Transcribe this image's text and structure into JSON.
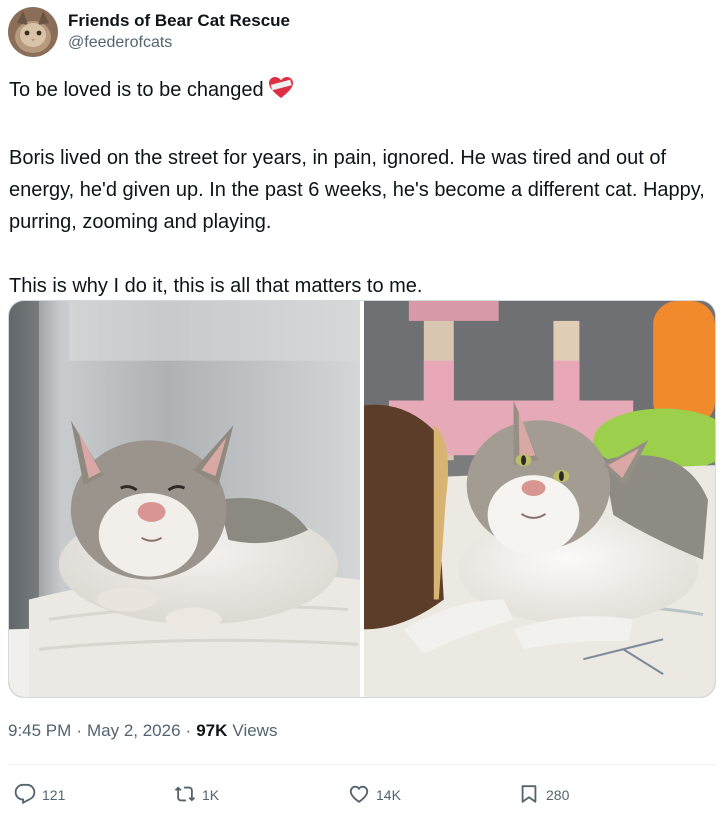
{
  "tweet": {
    "author": {
      "display_name": "Friends of Bear Cat Rescue",
      "handle": "@feederofcats"
    },
    "text": {
      "line1": "To be loved is to be changed",
      "line1_emoji": "heart-with-bandage",
      "para2": "Boris lived on the street for years, in pain, ignored. He was tired and out of energy, he'd given up. In the past 6 weeks, he's become a different cat. Happy, purring, zooming and playing.",
      "para3": "This is why I do it, this is all that matters to me."
    },
    "media": [
      {
        "subject": "cat-before-photo"
      },
      {
        "subject": "cat-after-photo"
      }
    ],
    "meta": {
      "time": "9:45 PM",
      "separator": "·",
      "date": "May 2, 2026",
      "views_count": "97K",
      "views_label": "Views"
    },
    "actions": {
      "reply_count": "121",
      "repost_count": "1K",
      "like_count": "14K",
      "bookmark_count": "280"
    },
    "colors": {
      "text_primary": "#0f1419",
      "text_secondary": "#536471",
      "divider": "#eff3f4"
    }
  }
}
